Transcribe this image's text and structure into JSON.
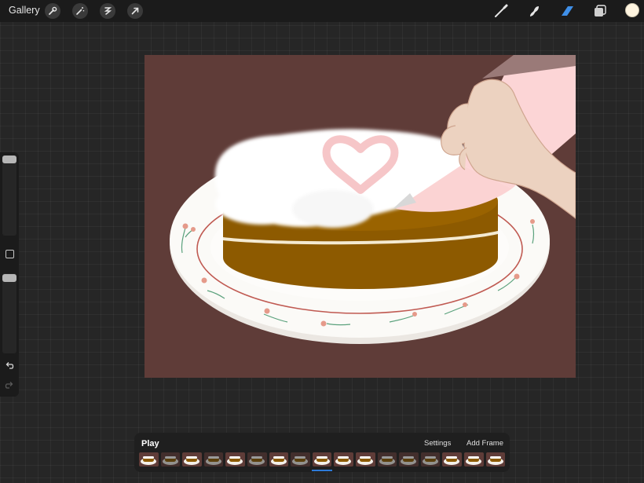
{
  "topbar": {
    "gallery_label": "Gallery",
    "left_tools": [
      "wrench-icon",
      "magic-wand-icon",
      "selection-icon",
      "transform-arrow-icon"
    ],
    "right_tools": [
      "brush-icon",
      "smudge-icon",
      "eraser-icon",
      "layers-icon"
    ],
    "active_tool": "eraser-icon",
    "active_tool_color": "#3f8fe8",
    "current_color": "#fff5e0"
  },
  "sidebar": {
    "brush_size_level": 0.95,
    "opacity_level": 0.95,
    "icons": [
      "modifier-square-icon",
      "undo-icon",
      "redo-icon"
    ]
  },
  "canvas": {
    "background_color": "#5f3c38",
    "subject": [
      "cake",
      "plate",
      "piping-bag",
      "hand",
      "heart"
    ]
  },
  "animation": {
    "play_label": "Play",
    "settings_label": "Settings",
    "add_frame_label": "Add Frame",
    "frame_count": 17,
    "selected_frame": 9,
    "frames": [
      {
        "onion": false
      },
      {
        "onion": true
      },
      {
        "onion": false
      },
      {
        "onion": true
      },
      {
        "onion": false
      },
      {
        "onion": true
      },
      {
        "onion": false
      },
      {
        "onion": true
      },
      {
        "onion": false
      },
      {
        "onion": false
      },
      {
        "onion": false
      },
      {
        "onion": true
      },
      {
        "onion": true
      },
      {
        "onion": true
      },
      {
        "onion": false
      },
      {
        "onion": false
      },
      {
        "onion": false
      }
    ]
  }
}
